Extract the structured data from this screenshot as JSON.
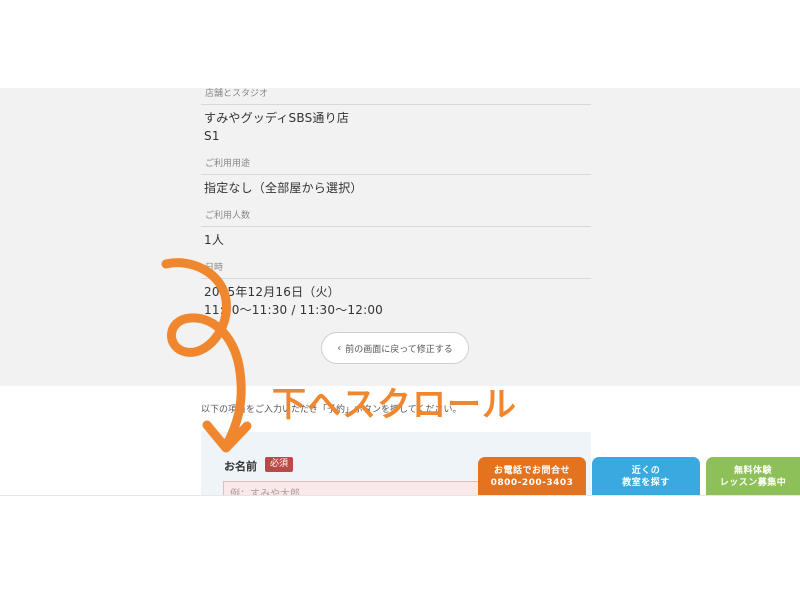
{
  "summary": {
    "store_label": "店舗とスタジオ",
    "store_name": "すみやグッディSBS通り店",
    "studio": "S1",
    "usage_label": "ご利用用途",
    "usage_value": "指定なし（全部屋から選択）",
    "people_label": "ご利用人数",
    "people_value": "1人",
    "datetime_label": "日時",
    "date_value": "2025年12月16日（火）",
    "time_value": "11:00〜11:30 / 11:30〜12:00"
  },
  "back_button": {
    "label": "前の画面に戻って修正する",
    "icon": "chevron-left-icon"
  },
  "instruction": "以下の項目をご入力いただき「予約」ボタンを押してください。",
  "form": {
    "name_label": "お名前",
    "required_badge": "必須",
    "name_placeholder": "例：すみや太郎"
  },
  "cta": {
    "phone_line1": "お電話でお問合せ",
    "phone_line2": "0800-200-3403",
    "near_line1": "近くの",
    "near_line2": "教室を探す",
    "trial_line1": "無料体験",
    "trial_line2": "レッスン募集中"
  },
  "annotation": {
    "text": "下へスクロール",
    "color": "#f0872f"
  },
  "colors": {
    "summary_bg": "#f2f2f2",
    "required": "#b94a48",
    "phone_cta": "#e3731e",
    "near_cta": "#39a9df",
    "trial_cta": "#8ec05a"
  }
}
